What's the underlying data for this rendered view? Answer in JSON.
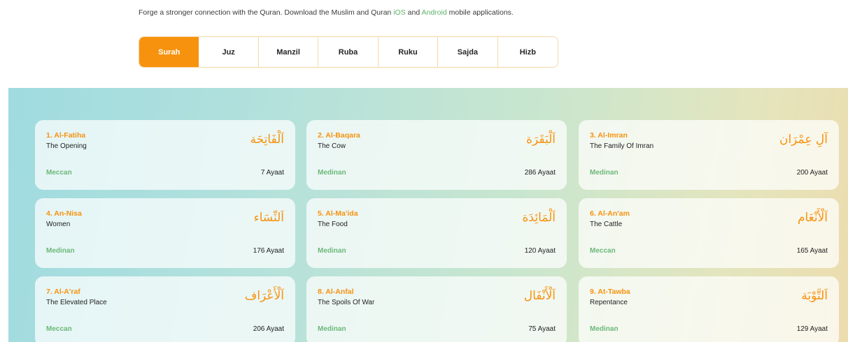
{
  "intro": {
    "text_before": "Forge a stronger connection with the Quran. Download the Muslim and Quran ",
    "ios_link": "iOS",
    "and": " and ",
    "android_link": "Android",
    "text_after": " mobile applications."
  },
  "tabs": [
    {
      "label": "Surah",
      "active": true
    },
    {
      "label": "Juz"
    },
    {
      "label": "Manzil"
    },
    {
      "label": "Ruba"
    },
    {
      "label": "Ruku"
    },
    {
      "label": "Sajda"
    },
    {
      "label": "Hizb"
    }
  ],
  "surahs": [
    {
      "name": "1. Al-Fatiha",
      "meaning": "The Opening",
      "arabic": "اَلْفَاتِحَة",
      "type": "Meccan",
      "ayaat": "7 Ayaat"
    },
    {
      "name": "2. Al-Baqara",
      "meaning": "The Cow",
      "arabic": "اَلْبَقَرَة",
      "type": "Medinan",
      "ayaat": "286 Ayaat"
    },
    {
      "name": "3. Al-Imran",
      "meaning": "The Family Of Imran",
      "arabic": "آلِ عِمْرَان",
      "type": "Medinan",
      "ayaat": "200 Ayaat"
    },
    {
      "name": "4. An-Nisa",
      "meaning": "Women",
      "arabic": "اَلنِّسَاء",
      "type": "Medinan",
      "ayaat": "176 Ayaat"
    },
    {
      "name": "5. Al-Ma'ida",
      "meaning": "The Food",
      "arabic": "اَلْمَائِدَة",
      "type": "Medinan",
      "ayaat": "120 Ayaat"
    },
    {
      "name": "6. Al-An'am",
      "meaning": "The Cattle",
      "arabic": "اَلْأَنْعَام",
      "type": "Meccan",
      "ayaat": "165 Ayaat"
    },
    {
      "name": "7. Al-A'raf",
      "meaning": "The Elevated Place",
      "arabic": "اَلْأَعْرَاف",
      "type": "Meccan",
      "ayaat": "206 Ayaat"
    },
    {
      "name": "8. Al-Anfal",
      "meaning": "The Spoils Of War",
      "arabic": "اَلْأَنْفَال",
      "type": "Medinan",
      "ayaat": "75 Ayaat"
    },
    {
      "name": "9. At-Tawba",
      "meaning": "Repentance",
      "arabic": "اَلتَّوْبَة",
      "type": "Medinan",
      "ayaat": "129 Ayaat"
    }
  ],
  "colors": {
    "accent": "#f7920f",
    "meccan_medinan": "#6cb87a",
    "link": "#5db26b"
  }
}
